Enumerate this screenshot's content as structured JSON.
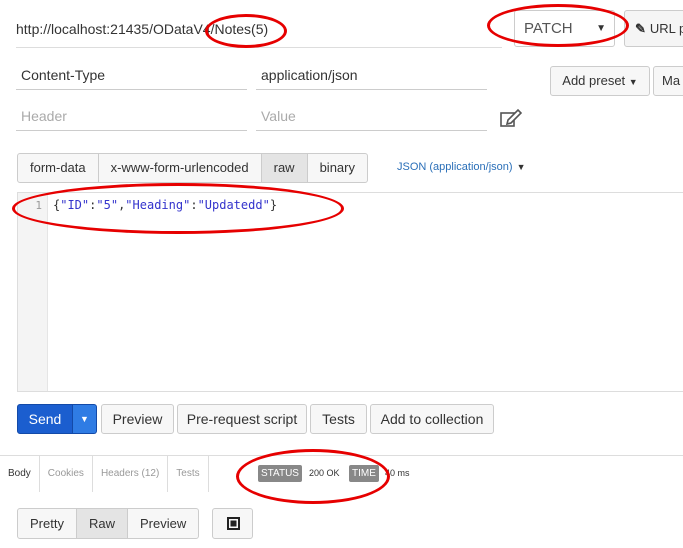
{
  "request": {
    "url": "http://localhost:21435/ODataV4/Notes(5)",
    "method": "PATCH",
    "url_params_label": "URL p"
  },
  "headers": {
    "rows": [
      {
        "key": "Content-Type",
        "value": "application/json"
      }
    ],
    "key_placeholder": "Header",
    "value_placeholder": "Value",
    "add_preset_label": "Add preset",
    "manage_label": "Ma"
  },
  "body": {
    "tabs": [
      "form-data",
      "x-www-form-urlencoded",
      "raw",
      "binary"
    ],
    "active_tab": "raw",
    "format_label": "JSON (application/json)",
    "line_number": "1",
    "code_tokens": [
      "{",
      "\"ID\"",
      ":",
      "\"5\"",
      ",",
      "\"Heading\"",
      ":",
      "\"Updatedd\"",
      "}"
    ]
  },
  "actions": {
    "send_label": "Send",
    "preview_label": "Preview",
    "prerequest_label": "Pre-request script",
    "tests_label": "Tests",
    "add_collection_label": "Add to collection"
  },
  "response": {
    "tabs": [
      "Body",
      "Cookies",
      "Headers (12)",
      "Tests"
    ],
    "active_tab": "Body",
    "status_label": "STATUS",
    "status_value": "200 OK",
    "time_label": "TIME",
    "time_value": "40 ms",
    "view_buttons": [
      "Pretty",
      "Raw",
      "Preview"
    ],
    "active_view": "Raw"
  },
  "colors": {
    "send_blue": "#1b5ecf",
    "annotation_red": "#e60000",
    "json_string": "#3333cc"
  }
}
